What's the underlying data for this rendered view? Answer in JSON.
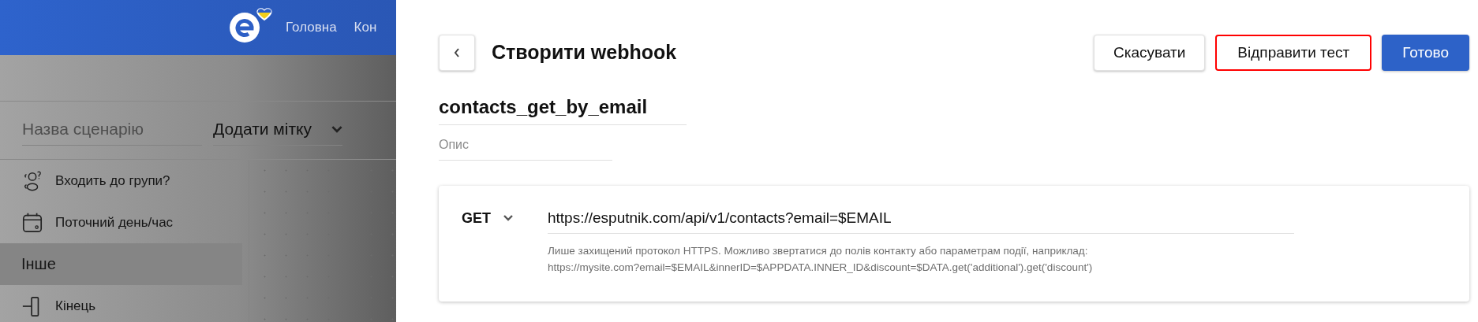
{
  "header": {
    "nav": [
      {
        "label": "Головна"
      },
      {
        "label": "Кон"
      }
    ]
  },
  "scenario": {
    "name_placeholder": "Назва сценарію",
    "tag_select": "Додати мітку"
  },
  "sidebar": {
    "items": [
      {
        "label": "Входить до групи?",
        "kind": "audience",
        "selected": false
      },
      {
        "label": "Поточний день/час",
        "kind": "calendar",
        "selected": false
      },
      {
        "label": "Інше",
        "kind": "category",
        "selected": true
      },
      {
        "label": "Кінець",
        "kind": "exit",
        "selected": false
      }
    ]
  },
  "dialog": {
    "title": "Створити webhook",
    "buttons": [
      {
        "label": "Скасувати",
        "kind": "secondary",
        "highlighted": false
      },
      {
        "label": "Відправити тест",
        "kind": "secondary",
        "highlighted": true
      },
      {
        "label": "Готово",
        "kind": "primary",
        "highlighted": false
      }
    ],
    "name": "contacts_get_by_email",
    "description_placeholder": "Опис",
    "request": {
      "method": "GET",
      "url": "https://esputnik.com/api/v1/contacts?email=$EMAIL",
      "hint": "Лише захищений протокол HTTPS. Можливо звертатися до полів контакту або параметрам події, наприклад:",
      "example": "https://mysite.com?email=$EMAIL&innerID=$APPDATA.INNER_ID&discount=$DATA.get('additional').get('discount')"
    }
  }
}
